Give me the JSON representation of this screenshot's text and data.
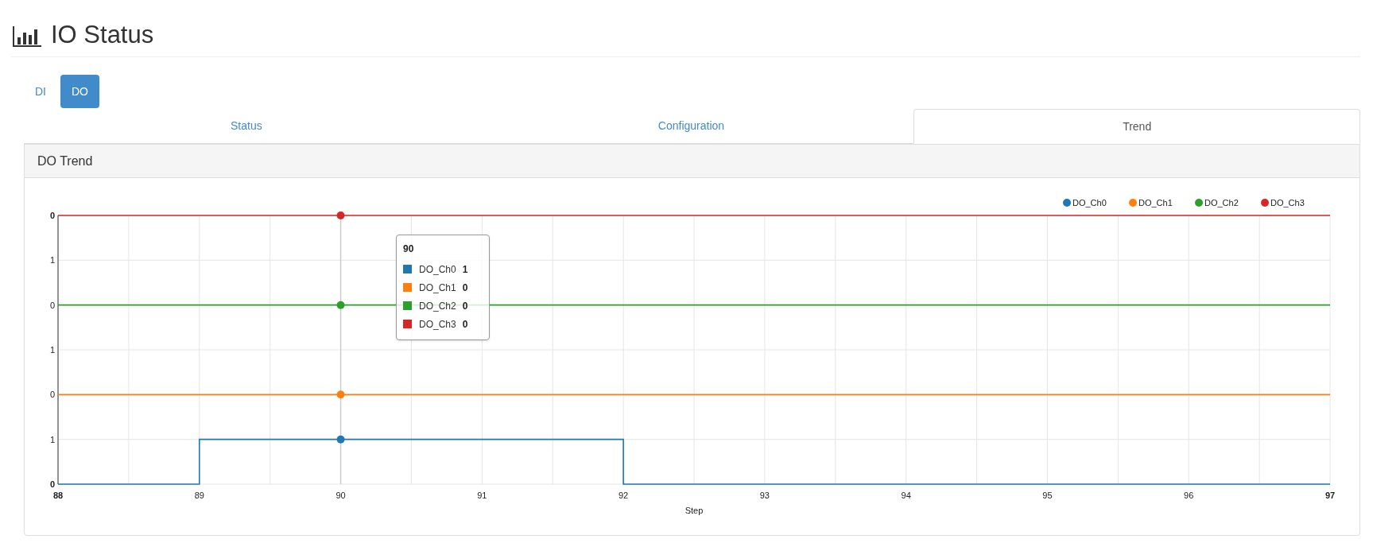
{
  "page_title": "IO Status",
  "io_tabs": [
    {
      "label": "DI",
      "selected": false
    },
    {
      "label": "DO",
      "selected": true
    }
  ],
  "view_tabs": [
    {
      "label": "Status",
      "selected": false
    },
    {
      "label": "Configuration",
      "selected": false
    },
    {
      "label": "Trend",
      "selected": true
    }
  ],
  "panel": {
    "title": "DO Trend",
    "chart": {
      "legend": [
        {
          "name": "DO_Ch0",
          "color": "#1f77b4"
        },
        {
          "name": "DO_Ch1",
          "color": "#ff7f0e"
        },
        {
          "name": "DO_Ch2",
          "color": "#2ca02c"
        },
        {
          "name": "DO_Ch3",
          "color": "#d62728"
        }
      ],
      "y_tick_labels": [
        "0",
        "1",
        "0",
        "1",
        "0",
        "1",
        "0"
      ],
      "x_tick_labels": [
        "88",
        "89",
        "90",
        "91",
        "92",
        "93",
        "94",
        "95",
        "96",
        "97"
      ],
      "x_axis_title": "Step"
    },
    "tooltip": {
      "title": "90",
      "rows": [
        {
          "name": "DO_Ch0",
          "value": "1",
          "color": "#1f77b4"
        },
        {
          "name": "DO_Ch1",
          "value": "0",
          "color": "#ff7f0e"
        },
        {
          "name": "DO_Ch2",
          "value": "0",
          "color": "#2ca02c"
        },
        {
          "name": "DO_Ch3",
          "value": "0",
          "color": "#d62728"
        }
      ]
    }
  }
}
